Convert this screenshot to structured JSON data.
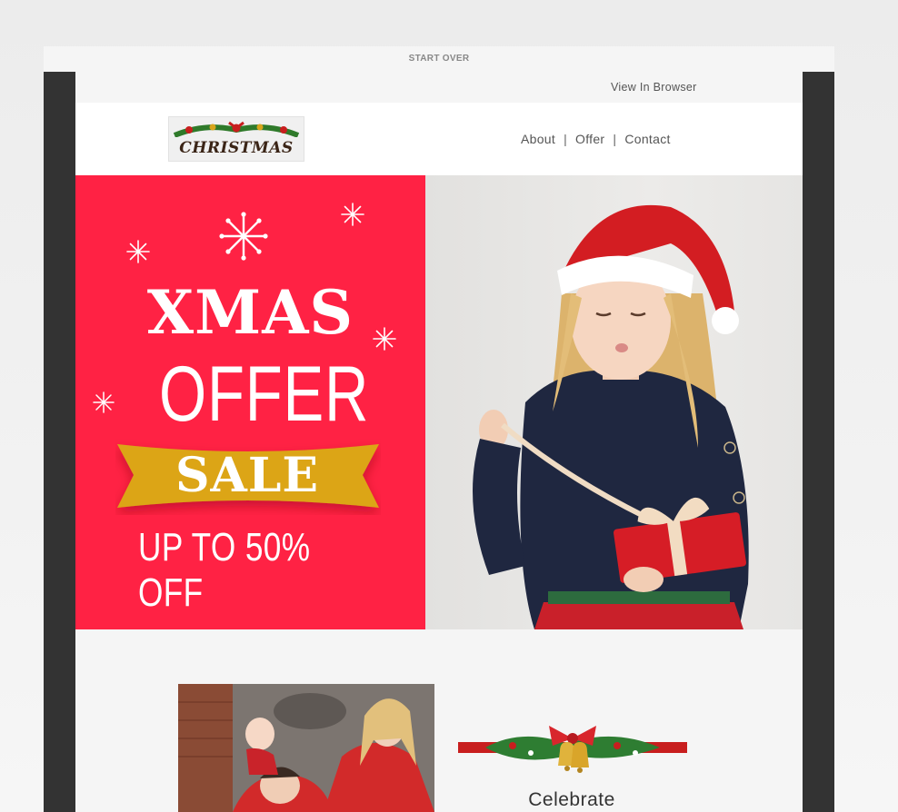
{
  "topbar": {
    "start_over": "START OVER"
  },
  "email": {
    "view_in_browser": "View In Browser",
    "logo": {
      "text": "CHRISTMAS"
    },
    "nav": [
      {
        "label": "About"
      },
      {
        "label": "Offer"
      },
      {
        "label": "Contact"
      }
    ],
    "nav_separator": "|",
    "hero": {
      "headline_1": "XMAS",
      "headline_2": "OFFER",
      "ribbon_text": "SALE",
      "discount": "UP TO 50% OFF",
      "colors": {
        "panel": "#ff2244",
        "ribbon": "#dca516",
        "text": "#ffffff"
      }
    },
    "section2": {
      "heading": "Celebrate"
    }
  },
  "icons": [
    "snowflake-icon",
    "christmas-bells-garland-icon"
  ]
}
